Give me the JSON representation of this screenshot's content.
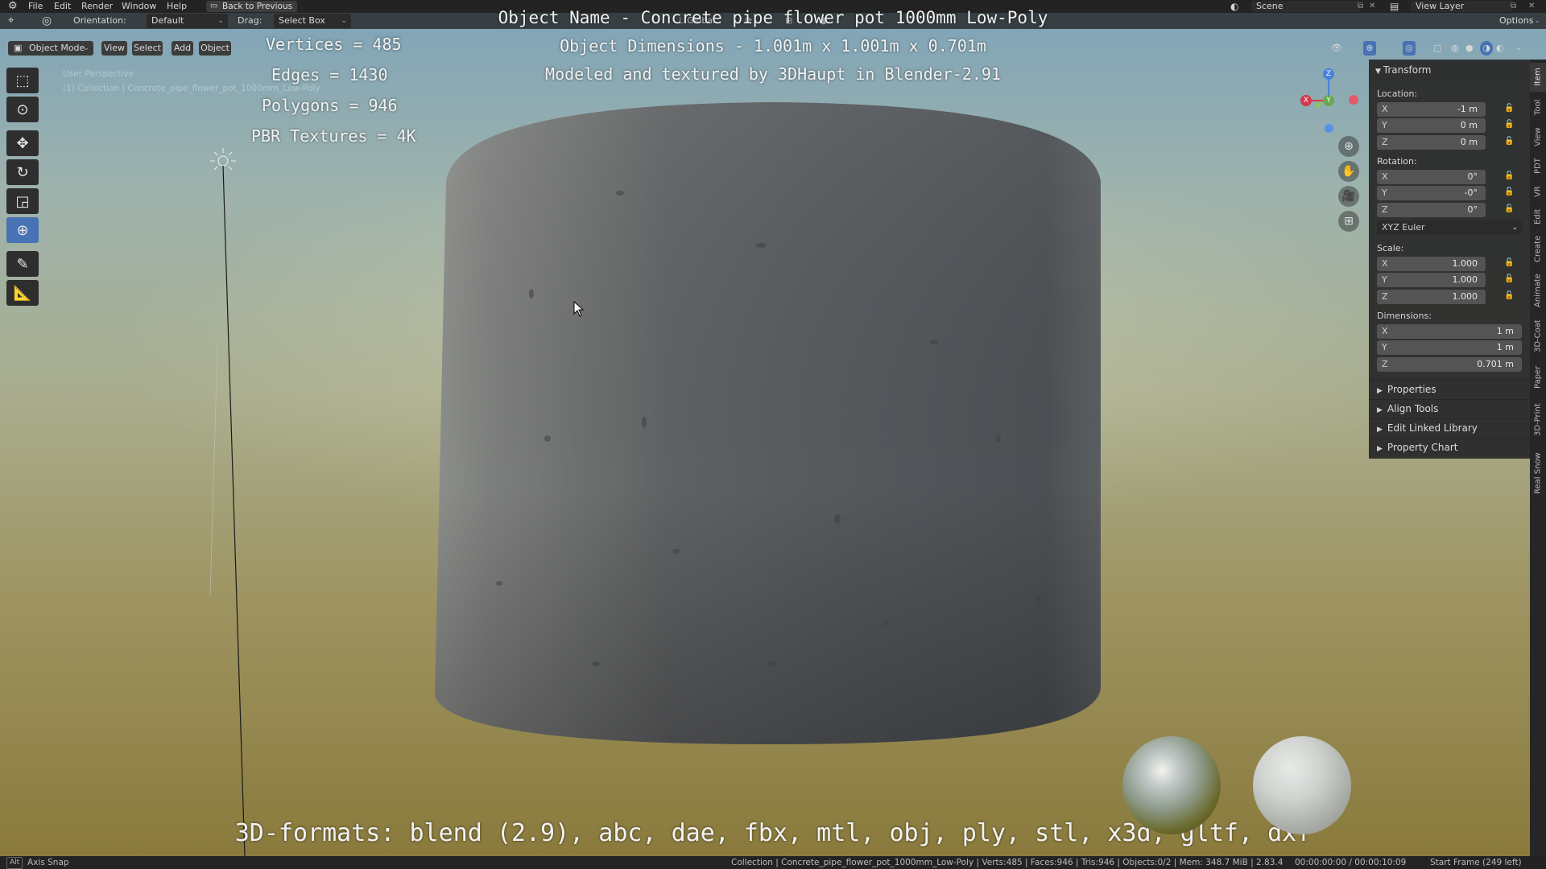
{
  "menubar": {
    "items": [
      "File",
      "Edit",
      "Render",
      "Window",
      "Help"
    ],
    "back_button": "Back to Previous",
    "scene": "Scene",
    "view_layer": "View Layer"
  },
  "header": {
    "orientation_label": "Orientation:",
    "orientation_value": "Default",
    "drag_label": "Drag:",
    "drag_value": "Select Box",
    "transform_global": "Global",
    "options": "Options"
  },
  "viewport_header": {
    "mode": "Object Mode",
    "menus": [
      "View",
      "Select",
      "Add",
      "Object"
    ]
  },
  "viewport": {
    "perspective_label": "User Perspective",
    "collection_label": "(1) Collection | Concrete_pipe_flower_pot_1000mm_Low-Poly"
  },
  "overlay_text": {
    "title": "Object Name - Concrete pipe flower pot 1000mm Low-Poly",
    "dimensions": "Object Dimensions -  1.001m x 1.001m x 0.701m",
    "credit": "Modeled and textured by 3DHaupt in Blender-2.91",
    "vertices": "Vertices = 485",
    "edges": "Edges = 1430",
    "polygons": "Polygons = 946",
    "textures": "PBR Textures = 4K",
    "formats": "3D-formats: blend (2.9), abc, dae, fbx, mtl, obj, ply, stl, x3d, gltf, dxf"
  },
  "npanel": {
    "title": "Transform",
    "location_label": "Location:",
    "location": [
      {
        "axis": "X",
        "value": "-1 m"
      },
      {
        "axis": "Y",
        "value": "0 m"
      },
      {
        "axis": "Z",
        "value": "0 m"
      }
    ],
    "rotation_label": "Rotation:",
    "rotation": [
      {
        "axis": "X",
        "value": "0°"
      },
      {
        "axis": "Y",
        "value": "-0°"
      },
      {
        "axis": "Z",
        "value": "0°"
      }
    ],
    "rotation_mode": "XYZ Euler",
    "scale_label": "Scale:",
    "scale": [
      {
        "axis": "X",
        "value": "1.000"
      },
      {
        "axis": "Y",
        "value": "1.000"
      },
      {
        "axis": "Z",
        "value": "1.000"
      }
    ],
    "dimensions_label": "Dimensions:",
    "dimensions": [
      {
        "axis": "X",
        "value": "1 m"
      },
      {
        "axis": "Y",
        "value": "1 m"
      },
      {
        "axis": "Z",
        "value": "0.701 m"
      }
    ],
    "sections": [
      "Properties",
      "Align Tools",
      "Edit Linked Library",
      "Property Chart"
    ]
  },
  "side_tabs": [
    "Item",
    "Tool",
    "View",
    "PDT",
    "VR",
    "Edit",
    "Create",
    "Animate",
    "3D-Coat",
    "Paper",
    "3D-Print",
    "Real Snow"
  ],
  "statusbar": {
    "left_key": "Alt",
    "left_label": "Axis Snap",
    "info": "Collection | Concrete_pipe_flower_pot_1000mm_Low-Poly | Verts:485 | Faces:946 | Tris:946 | Objects:0/2 | Mem: 348.7 MiB | 2.83.4",
    "time": "00:00:00:00 / 00:00:10:09",
    "frame": "Start Frame (249 left)"
  }
}
